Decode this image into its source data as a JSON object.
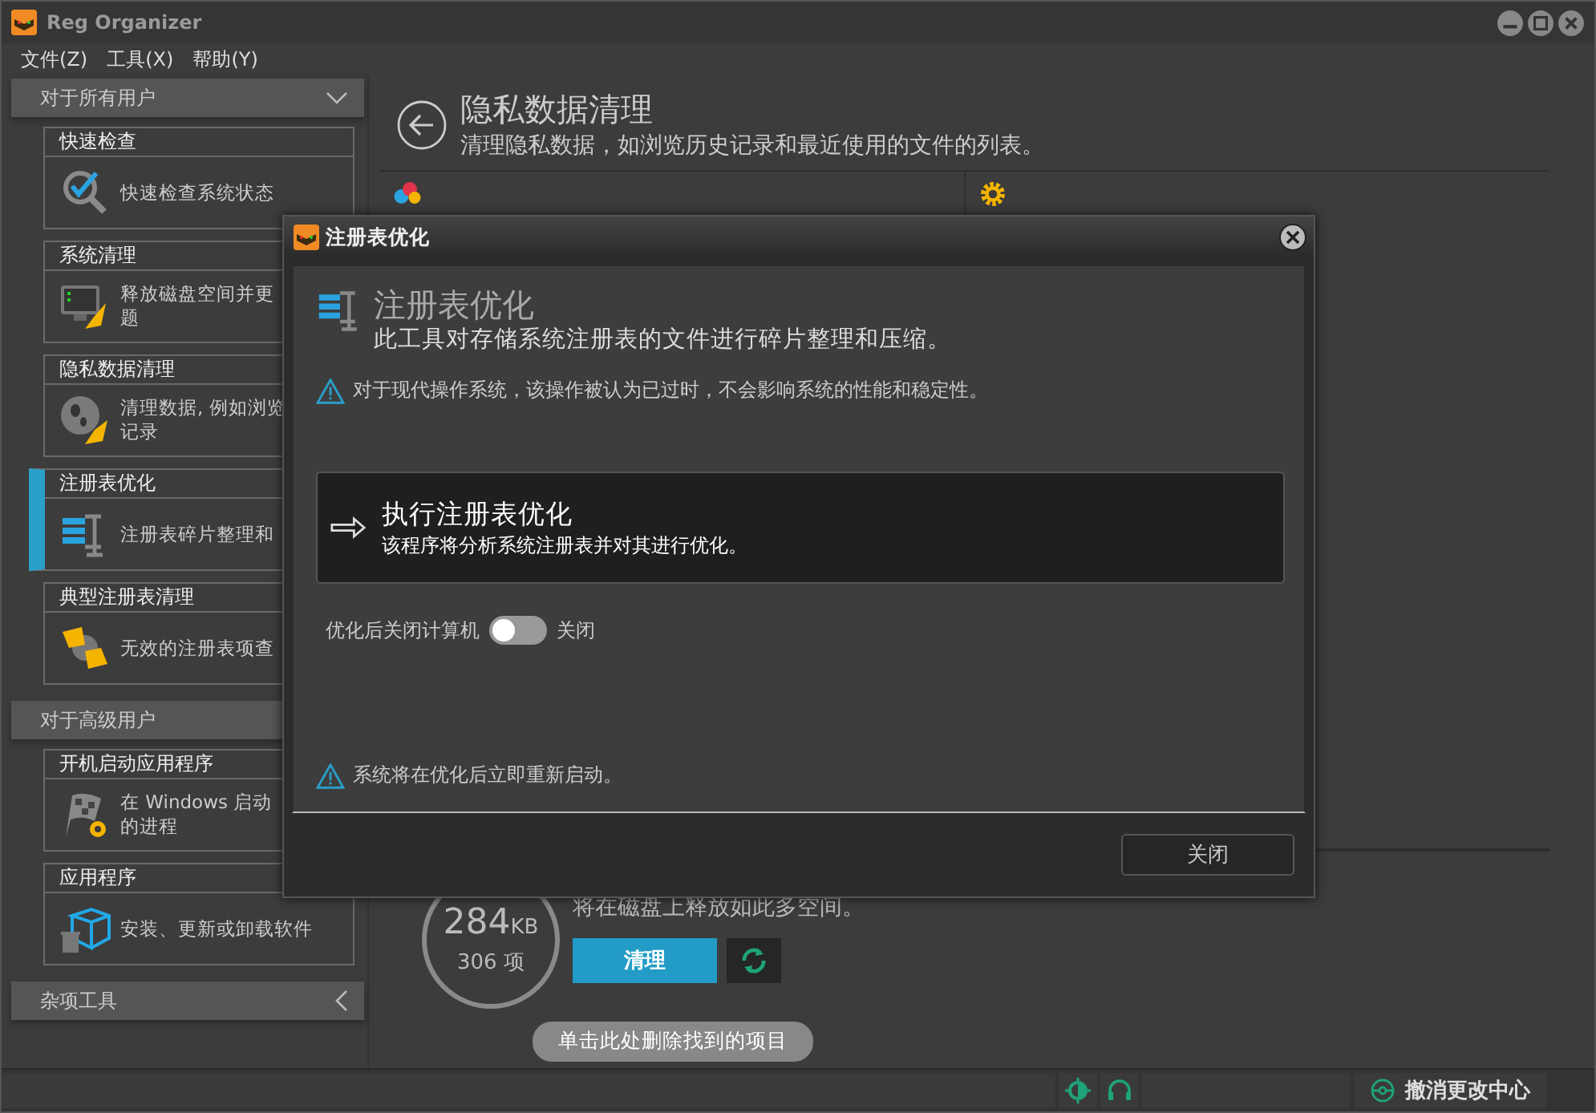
{
  "window": {
    "title": "Reg Organizer"
  },
  "menu": [
    "文件(Z)",
    "工具(X)",
    "帮助(Y)"
  ],
  "sidebar": {
    "groups": [
      {
        "title": "对于所有用户",
        "expanded": true,
        "cards": [
          {
            "title": "快速检查",
            "kind": "check",
            "lines": [
              "快速检查系统状态"
            ],
            "selected": false
          },
          {
            "title": "系统清理",
            "kind": "monitor",
            "lines": [
              "释放磁盘空间并更",
              "题"
            ],
            "selected": false
          },
          {
            "title": "隐私数据清理",
            "kind": "privacy",
            "lines": [
              "清理数据, 例如浏览",
              "记录"
            ],
            "selected": false
          },
          {
            "title": "注册表优化",
            "kind": "registry",
            "lines": [
              "注册表碎片整理和"
            ],
            "selected": true
          },
          {
            "title": "典型注册表清理",
            "kind": "broom",
            "lines": [
              "无效的注册表项查"
            ],
            "selected": false
          }
        ]
      },
      {
        "title": "对于高级用户",
        "cards": [
          {
            "title": "开机启动应用程序",
            "kind": "flag",
            "lines": [
              "在 Windows 启动",
              "的进程"
            ],
            "selected": false
          },
          {
            "title": "应用程序",
            "kind": "box",
            "lines": [
              "安装、更新或卸载软件"
            ],
            "selected": false
          }
        ]
      },
      {
        "title": "杂项工具",
        "expanded": false
      }
    ]
  },
  "page": {
    "title": "隐私数据清理",
    "subtitle": "清理隐私数据，如浏览历史记录和最近使用的文件的列表。",
    "size": "284",
    "unit": "KB",
    "count": "306 项",
    "size_note": "将在磁盘上释放如此多空间。",
    "clean_button": "清理",
    "tooltip": "单击此处删除找到的项目"
  },
  "status_bar": {
    "undo_center": "撤消更改中心"
  },
  "dialog": {
    "title": "注册表优化",
    "heading": "注册表优化",
    "description": "此工具对存储系统注册表的文件进行碎片整理和压缩。",
    "warning": "对于现代操作系统，该操作被认为已过时，不会影响系统的性能和稳定性。",
    "action": {
      "title": "执行注册表优化",
      "description": "该程序将分析系统注册表并对其进行优化。"
    },
    "shutdown": {
      "label": "优化后关闭计算机",
      "on": false,
      "state": "关闭"
    },
    "note": "系统将在优化后立即重新启动。",
    "close_button": "关闭"
  }
}
